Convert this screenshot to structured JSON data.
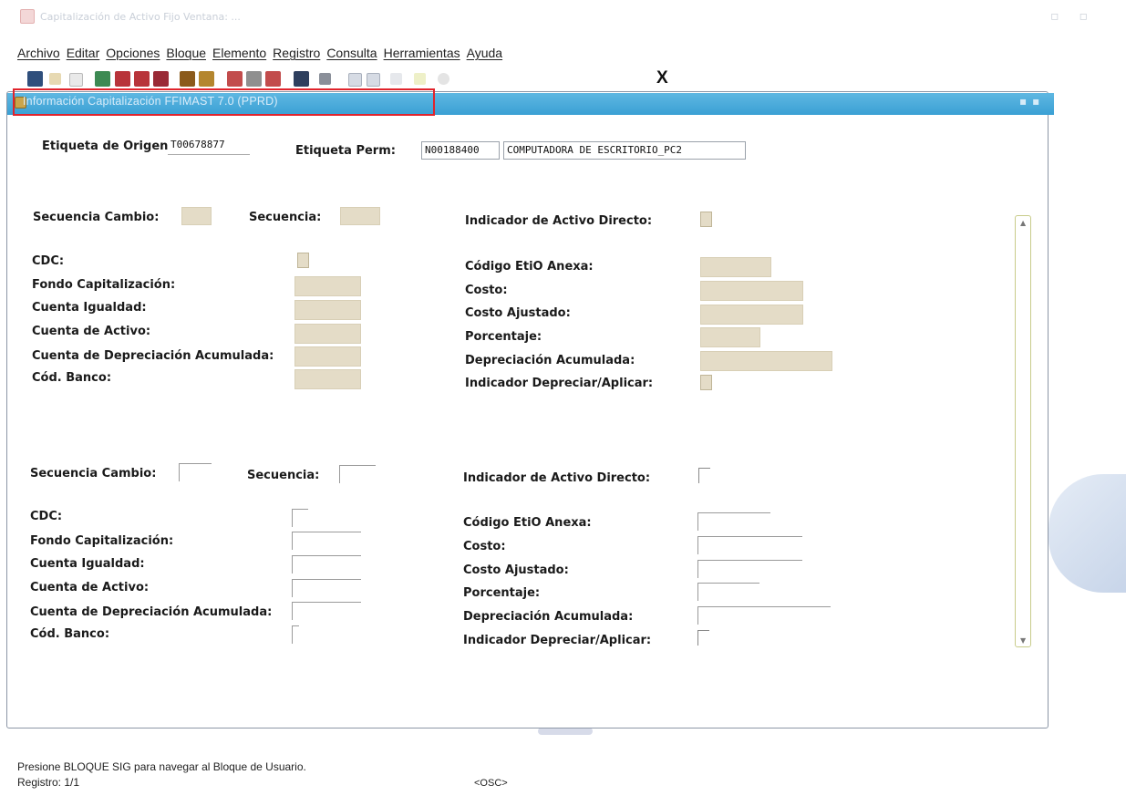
{
  "app": {
    "window_title": "Capitalización de Activo Fijo Ventana: ..."
  },
  "menu": [
    "Archivo",
    "Editar",
    "Opciones",
    "Bloque",
    "Elemento",
    "Registro",
    "Consulta",
    "Herramientas",
    "Ayuda"
  ],
  "toolbar": {
    "icons": [
      "save-icon",
      "rollback-icon",
      "print-icon",
      "previous-block-icon",
      "next-block-icon",
      "previous-record-icon",
      "next-record-icon",
      "insert-record-icon",
      "remove-record-icon",
      "enter-query-icon",
      "execute-query-icon",
      "cancel-query-icon",
      "help-icon",
      "print-form-icon",
      "attachment-icon",
      "bookmark-icon",
      "options-icon",
      "settings-icon",
      "info-icon"
    ],
    "exit_label": "X"
  },
  "form": {
    "title": "Información Capitalización FFIMAST 7.0 (PPRD)",
    "header": {
      "origin_tag_label": "Etiqueta de Origen:",
      "origin_tag_value": "T00678877",
      "perm_tag_label": "Etiqueta Perm:",
      "perm_tag_value": "N00188400",
      "perm_tag_description": "COMPUTADORA DE ESCRITORIO_PC2"
    },
    "labels": {
      "change_seq": "Secuencia Cambio:",
      "sequence": "Secuencia:",
      "direct_asset_ind": "Indicador de Activo Directo:",
      "coas": "CDC:",
      "cap_fund": "Fondo Capitalización:",
      "equity_account": "Cuenta Igualdad:",
      "asset_account": "Cuenta de Activo:",
      "accum_depr_account": "Cuenta de Depreciación Acumulada:",
      "bank_code": "Cód. Banco:",
      "attached_tag_code": "Código EtiO Anexa:",
      "cost": "Costo:",
      "adjusted_cost": "Costo Ajustado:",
      "percentage": "Porcentaje:",
      "accum_depreciation": "Depreciación Acumulada:",
      "depr_apply_ind": "Indicador Depreciar/Aplicar:"
    }
  },
  "status": {
    "message": "Presione BLOQUE SIG para navegar al Bloque de Usuario.",
    "record": "Registro: 1/1",
    "mode": "<OSC>"
  },
  "colors": {
    "titlebar": "#3aa0d4",
    "highlight_box": "#e0242c",
    "disabled_field": "#e4dcc7"
  }
}
